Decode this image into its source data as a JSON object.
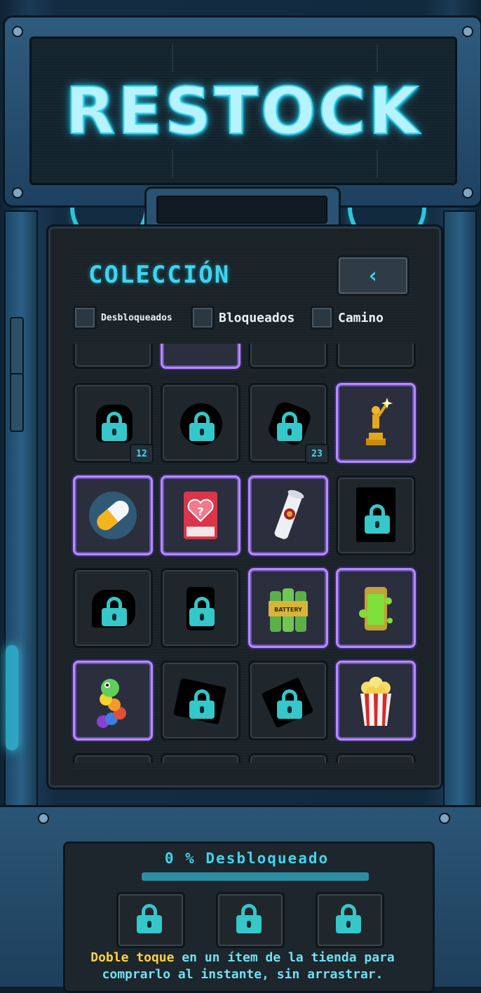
{
  "header": {
    "logo": "RESTOCK"
  },
  "collection": {
    "title": "COLECCIÓN",
    "back_icon": "chevron-left-icon",
    "filters": [
      {
        "label": "Desbloqueados",
        "checked": false
      },
      {
        "label": "Bloqueados",
        "checked": false
      },
      {
        "label": "Camino",
        "checked": false
      }
    ]
  },
  "grid": {
    "rows": [
      [
        {
          "state": "locked",
          "shape": "frog",
          "badge": "12"
        },
        {
          "state": "locked",
          "shape": "bomb"
        },
        {
          "state": "locked",
          "shape": "hexagon",
          "badge": "23"
        },
        {
          "state": "unlocked",
          "item": "golden-statue-trophy"
        }
      ],
      [
        {
          "state": "unlocked",
          "item": "pill-capsule"
        },
        {
          "state": "unlocked",
          "item": "heart-card-pack"
        },
        {
          "state": "unlocked",
          "item": "scroll-with-seal"
        },
        {
          "state": "locked",
          "shape": "rectangle"
        }
      ],
      [
        {
          "state": "locked",
          "shape": "speech-bubble"
        },
        {
          "state": "locked",
          "shape": "bottle"
        },
        {
          "state": "unlocked",
          "item": "battery-pack"
        },
        {
          "state": "unlocked",
          "item": "toxic-battery"
        }
      ],
      [
        {
          "state": "unlocked",
          "item": "rainbow-worm"
        },
        {
          "state": "locked",
          "shape": "tilted-card"
        },
        {
          "state": "locked",
          "shape": "tilted-card"
        },
        {
          "state": "unlocked",
          "item": "popcorn-bucket"
        }
      ]
    ]
  },
  "progress": {
    "label": "0 % Desbloqueado",
    "percent": 0
  },
  "categories": [
    {
      "icon": "locked-box-icon"
    },
    {
      "icon": "locked-magnifier-icon"
    },
    {
      "icon": "locked-bomb-icon"
    }
  ],
  "hint": {
    "highlight": "Doble toque",
    "line1": " en un ítem de la tienda para",
    "line2": "comprarlo al instante, sin arrastrar."
  },
  "colors": {
    "accent": "#3fd4ee",
    "lock": "#35c7c9",
    "unlocked_border": "#b48cff",
    "highlight": "#ffd23c"
  }
}
